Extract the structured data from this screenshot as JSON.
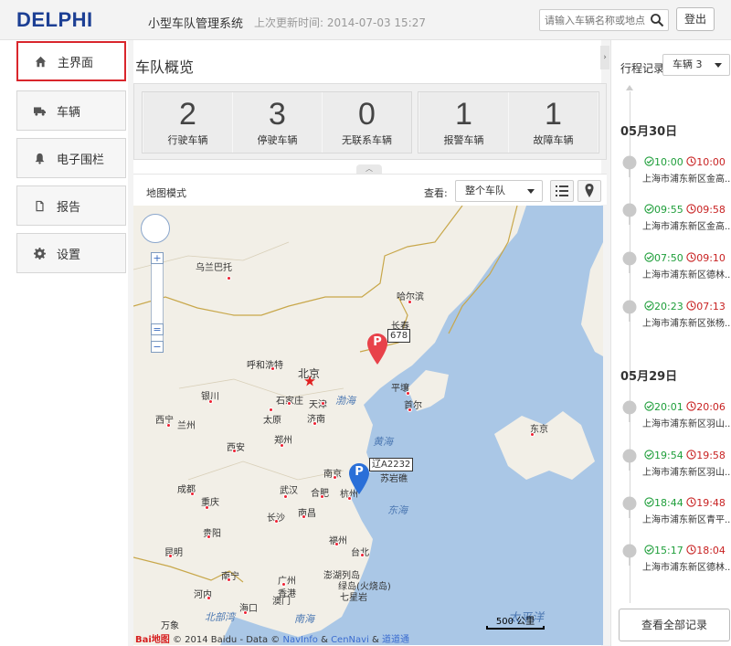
{
  "header": {
    "logo": "DELPHI",
    "app_title": "小型车队管理系统",
    "last_update": "上次更新时间: 2014-07-03 15:27",
    "search_placeholder": "请输入车辆名称或地点",
    "logout_label": "登出"
  },
  "sidebar": {
    "items": [
      {
        "label": "主界面",
        "icon": "home-icon",
        "active": true
      },
      {
        "label": "车辆",
        "icon": "truck-icon"
      },
      {
        "label": "电子围栏",
        "icon": "bell-icon"
      },
      {
        "label": "报告",
        "icon": "document-icon"
      },
      {
        "label": "设置",
        "icon": "gear-icon"
      }
    ]
  },
  "overview": {
    "title": "车队概览",
    "stats": [
      {
        "value": "2",
        "label": "行驶车辆"
      },
      {
        "value": "3",
        "label": "停驶车辆"
      },
      {
        "value": "0",
        "label": "无联系车辆"
      },
      {
        "value": "1",
        "label": "报警车辆"
      },
      {
        "value": "1",
        "label": "故障车辆"
      }
    ]
  },
  "map_toolbar": {
    "mode_label": "地图模式",
    "view_label": "查看:",
    "view_selected": "整个车队"
  },
  "map": {
    "cities": [
      "乌兰巴托",
      "哈尔滨",
      "长春",
      "呼和浩特",
      "北京",
      "天津",
      "石家庄",
      "银川",
      "太原",
      "济南",
      "西宁",
      "兰州",
      "郑州",
      "西安",
      "平壤",
      "首尔",
      "东京",
      "南京",
      "合肥",
      "武汉",
      "杭州",
      "成都",
      "重庆",
      "长沙",
      "南昌",
      "贵阳",
      "福州",
      "昆明",
      "台北",
      "南宁",
      "广州",
      "香港",
      "澳门",
      "河内",
      "海口",
      "万象",
      "苏岩礁",
      "澎湖列岛",
      "绿岛(火烧岛)",
      "七星岩"
    ],
    "seas": [
      "渤海",
      "黄海",
      "东海",
      "北部湾",
      "南海",
      "太平洋"
    ],
    "markers": [
      {
        "letter": "P",
        "label": "678",
        "color": "#e8424a"
      },
      {
        "letter": "P",
        "label": "辽A2232",
        "color": "#2a6fd8"
      }
    ],
    "scale": "500 公里",
    "attribution": "© 2014 Baidu - Data ©",
    "attribution_links": [
      "NavInfo",
      "CenNavi",
      "道道通"
    ],
    "baidu_brand": "Bai地图"
  },
  "trips": {
    "label": "行程记录",
    "vehicle_selected": "车辆 3",
    "days": [
      {
        "date": "05月30日",
        "items": [
          {
            "start": "10:00",
            "end": "10:00",
            "addr": "上海市浦东新区金高..."
          },
          {
            "start": "09:55",
            "end": "09:58",
            "addr": "上海市浦东新区金高..."
          },
          {
            "start": "07:50",
            "end": "09:10",
            "addr": "上海市浦东新区德林..."
          },
          {
            "start": "20:23",
            "end": "07:13",
            "addr": "上海市浦东新区张杨..."
          }
        ]
      },
      {
        "date": "05月29日",
        "items": [
          {
            "start": "20:01",
            "end": "20:06",
            "addr": "上海市浦东新区羽山..."
          },
          {
            "start": "19:54",
            "end": "19:58",
            "addr": "上海市浦东新区羽山..."
          },
          {
            "start": "18:44",
            "end": "19:48",
            "addr": "上海市浦东新区青平..."
          },
          {
            "start": "15:17",
            "end": "18:04",
            "addr": "上海市浦东新区德林..."
          }
        ]
      }
    ],
    "view_all_label": "查看全部记录"
  },
  "colors": {
    "accent_red": "#d9262c",
    "brand_blue": "#1c3f94",
    "start_green": "#1e9e3a",
    "end_red": "#c82222"
  }
}
